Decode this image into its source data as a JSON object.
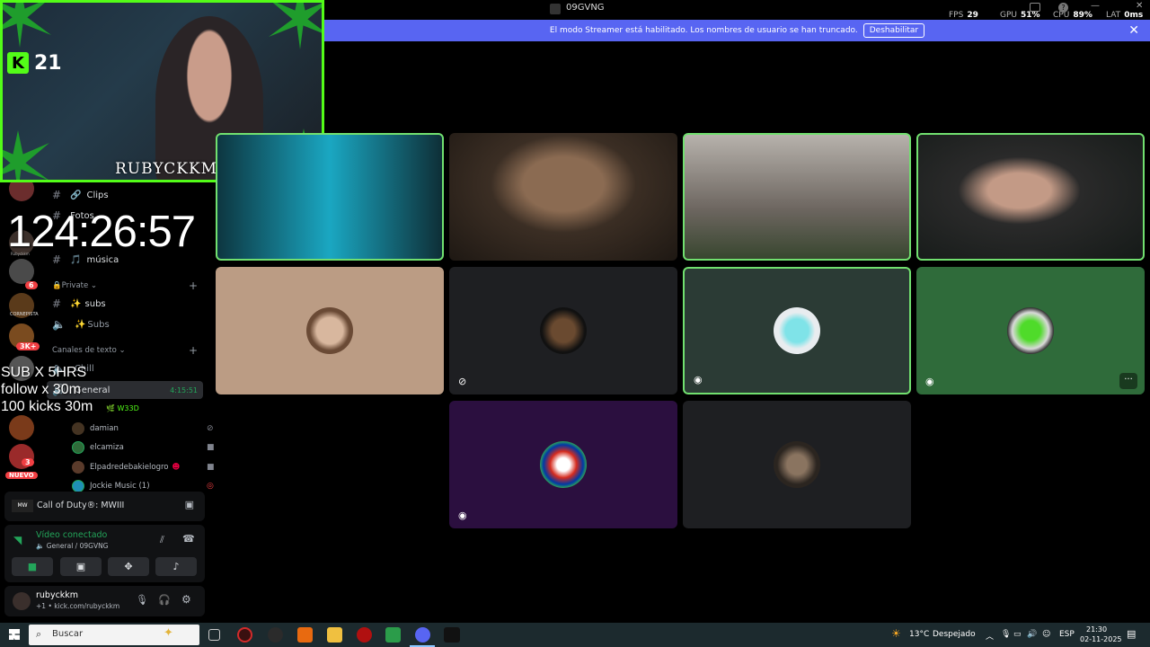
{
  "window": {
    "title": "09GVNG"
  },
  "perf": [
    {
      "label": "FPS",
      "value": "29"
    },
    {
      "label": "GPU",
      "value": "51%"
    },
    {
      "label": "CPU",
      "value": "89%"
    },
    {
      "label": "LAT",
      "value": "0ms"
    }
  ],
  "banner": {
    "text": "El modo Streamer está habilitado. Los nombres de usuario se han truncado.",
    "button": "Deshabilitar",
    "close": "✕"
  },
  "overlay": {
    "kick_count": "21",
    "cam_name": "RUBYCKKM",
    "timer": "124:26:57",
    "goals": [
      "SUB X 5HRS",
      "follow x 30m",
      "100 kicks 30m"
    ]
  },
  "rail": {
    "labels": [
      "Rubyckkm",
      "CORNEPISTA",
      "NUEVO"
    ],
    "badges": [
      "6",
      "3K+",
      "3"
    ]
  },
  "channels": {
    "items": [
      {
        "name": "Clips"
      },
      {
        "name": "Fotos"
      },
      {
        "name": "música"
      }
    ],
    "private_category": "Private",
    "private_items": [
      {
        "name": "subs"
      },
      {
        "name": "Subs"
      }
    ],
    "text_category": "Canales de texto",
    "text_items": [
      {
        "name": "Chill"
      },
      {
        "name": "General",
        "time": "4:15:51"
      }
    ],
    "voice_tag": "W33D",
    "members": [
      {
        "name": "damian"
      },
      {
        "name": "elcamiza"
      },
      {
        "name": "Elpadredebakielogro"
      },
      {
        "name": "Jockie Music (1)"
      }
    ]
  },
  "activity": {
    "game": "Call of Duty®: MWIII"
  },
  "voice": {
    "status": "Vídeo conectado",
    "location": "General / 09GVNG"
  },
  "user": {
    "name": "rubyckkm",
    "status": "+1 • kick.com/rubyckkm"
  },
  "taskbar": {
    "search_placeholder": "Buscar",
    "weather": "13°C",
    "weather_desc": "Despejado",
    "lang": "ESP",
    "time": "21:30",
    "date": "02-11-2025"
  },
  "colors": {
    "kick_green": "#53fc18",
    "discord_blurple": "#5865f2",
    "speaking_green": "#71e06f"
  }
}
